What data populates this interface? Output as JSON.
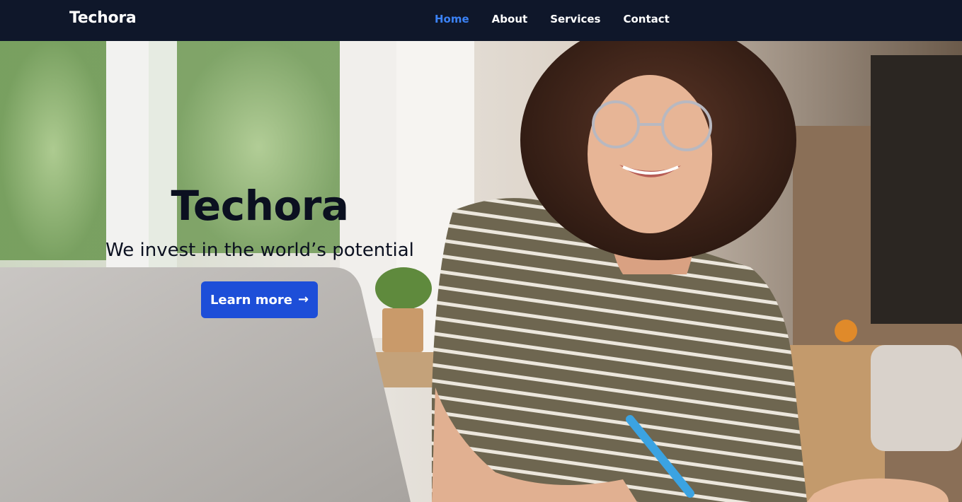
{
  "navbar": {
    "brand": "Techora",
    "links": [
      {
        "label": "Home",
        "active": true
      },
      {
        "label": "About",
        "active": false
      },
      {
        "label": "Services",
        "active": false
      },
      {
        "label": "Contact",
        "active": false
      }
    ]
  },
  "hero": {
    "title": "Techora",
    "subtitle": "We invest in the world’s potential",
    "cta_label": "Learn more",
    "cta_icon": "arrow-right-icon",
    "cta_glyph": "→",
    "image": "woman-with-laptop-photo"
  },
  "colors": {
    "navbar_bg": "#0f172a",
    "active_link": "#3b82f6",
    "button_bg": "#1d4ed8",
    "text_dark": "#0b1020"
  }
}
